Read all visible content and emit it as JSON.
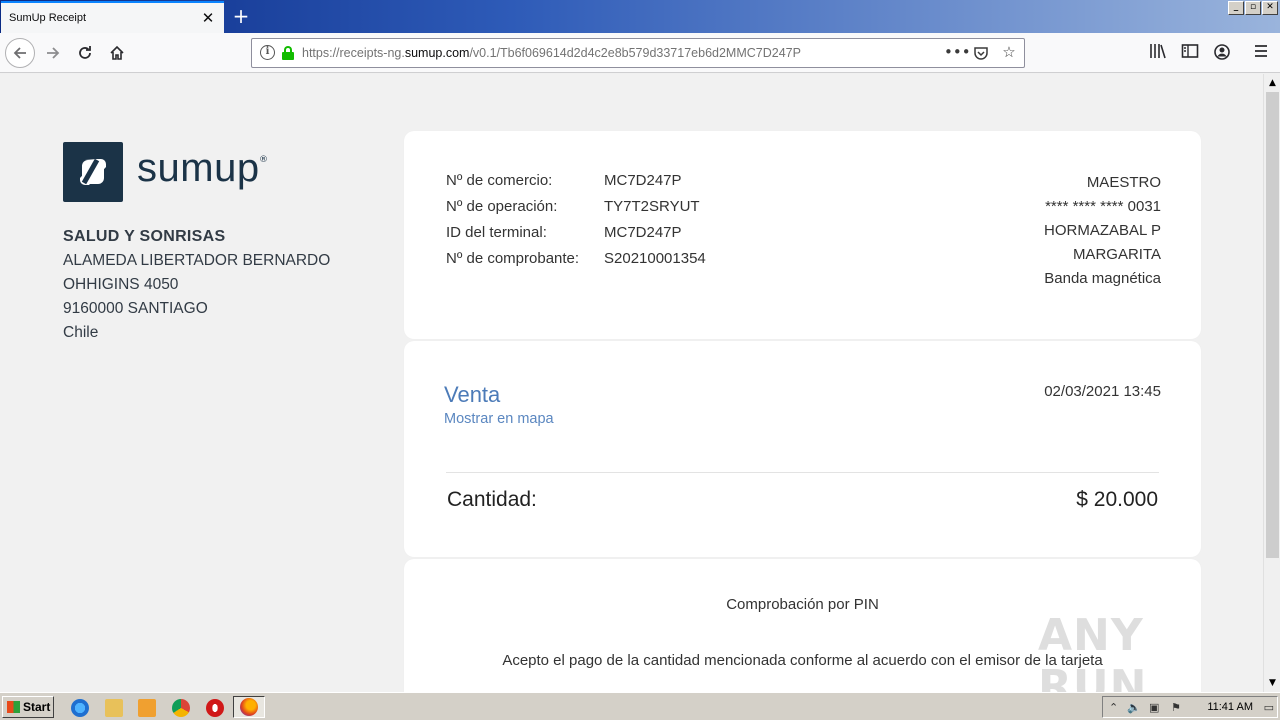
{
  "browser": {
    "tab_title": "SumUp Receipt",
    "tab_close": "✕",
    "new_tab": "+",
    "url_prefix": "https://receipts-ng.",
    "url_domain": "sumup.com",
    "url_path": "/v0.1/Tb6f069614d2d4c2e8b579d33717eb6d2MMC7D247P",
    "window_controls": [
      "_",
      "▫",
      "✕"
    ],
    "icons": [
      "back-icon",
      "forward-icon",
      "reload-icon",
      "home-icon",
      "info-icon",
      "lock-icon",
      "more-icon",
      "pocket-icon",
      "bookmark-star-icon",
      "library-icon",
      "sidebar-icon",
      "account-icon",
      "menu-icon"
    ]
  },
  "merchant": {
    "logo_text": "sumup",
    "logo_reg": "®",
    "name": "SALUD Y SONRISAS",
    "address_lines": [
      "ALAMEDA LIBERTADOR BERNARDO",
      "OHHIGINS 4050",
      "9160000 SANTIAGO",
      "Chile"
    ]
  },
  "receipt": {
    "fields": [
      {
        "label": "Nº de comercio:",
        "value": "MC7D247P"
      },
      {
        "label": "Nº de operación:",
        "value": "TY7T2SRYUT"
      },
      {
        "label": "ID del terminal:",
        "value": "MC7D247P"
      },
      {
        "label": "Nº de comprobante:",
        "value": "S20210001354"
      }
    ],
    "card_info": [
      "MAESTRO",
      "**** **** **** 0031",
      "HORMAZABAL P",
      "MARGARITA",
      "Banda magnética"
    ],
    "transaction_type": "Venta",
    "map_link": "Mostrar en mapa",
    "datetime": "02/03/2021 13:45",
    "amount_label": "Cantidad:",
    "amount_value": "$ 20.000",
    "pin_title": "Comprobación por PIN",
    "pin_text": "Acepto el pago de la cantidad mencionada conforme al acuerdo con el emisor de la tarjeta"
  },
  "watermark": "ANY RUN",
  "taskbar": {
    "start_label": "Start",
    "clock": "11:41 AM"
  },
  "colors": {
    "brand_dark": "#1b3347",
    "link_blue": "#4c7bb8",
    "secure_green": "#12bc00"
  }
}
